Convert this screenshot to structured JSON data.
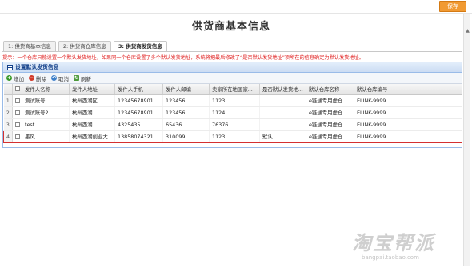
{
  "header": {
    "save_label": "保存",
    "title": "供货商基本信息"
  },
  "tabs": [
    {
      "label": "1: 供货商基本信息",
      "active": false
    },
    {
      "label": "2: 供货商仓库信息",
      "active": false
    },
    {
      "label": "3: 供货商发货信息",
      "active": true
    }
  ],
  "tip": "提示：一个仓库只能设置一个默认发货地址，如果同一个仓库设置了多个默认发货地址，系统将把最后修改了“是否默认发货地址”项所在的信息确定为默认发货地址。",
  "panel": {
    "title": "设置默认发货信息"
  },
  "toolbar": {
    "add": "增加",
    "delete": "删除",
    "cancel": "取消",
    "refresh": "刷新"
  },
  "grid": {
    "columns": [
      "发件人名称",
      "发件人地址",
      "发件人手机",
      "发件人邮编",
      "卖家所在地国家...",
      "是否默认发货地...",
      "默认仓库名称",
      "默认仓库编号"
    ],
    "rows": [
      {
        "n": "1",
        "cells": [
          "测试账号",
          "杭州西湖区",
          "12345678901",
          "123456",
          "1123",
          "",
          "e链通专用虚仓",
          "ELINK-9999"
        ]
      },
      {
        "n": "2",
        "cells": [
          "测试账号2",
          "杭州西湖",
          "12345678901",
          "123456",
          "1124",
          "",
          "e链通专用虚仓",
          "ELINK-9999"
        ]
      },
      {
        "n": "3",
        "cells": [
          "test",
          "杭州西湖",
          "4325435",
          "65436",
          "76376",
          "",
          "e链通专用虚仓",
          "ELINK-9999"
        ]
      },
      {
        "n": "4",
        "cells": [
          "墨风",
          "杭州西湖创业大...",
          "13858074321",
          "310099",
          "1123",
          "默认",
          "e链通专用虚仓",
          "ELINK-9999"
        ]
      }
    ]
  },
  "watermark": {
    "big": "淘宝帮派",
    "small": "bangpai.taobao.com"
  },
  "colors": {
    "save": "#f19a32",
    "tip": "#e02020",
    "highlight": "#d43030",
    "panel_border": "#99bbe8"
  }
}
